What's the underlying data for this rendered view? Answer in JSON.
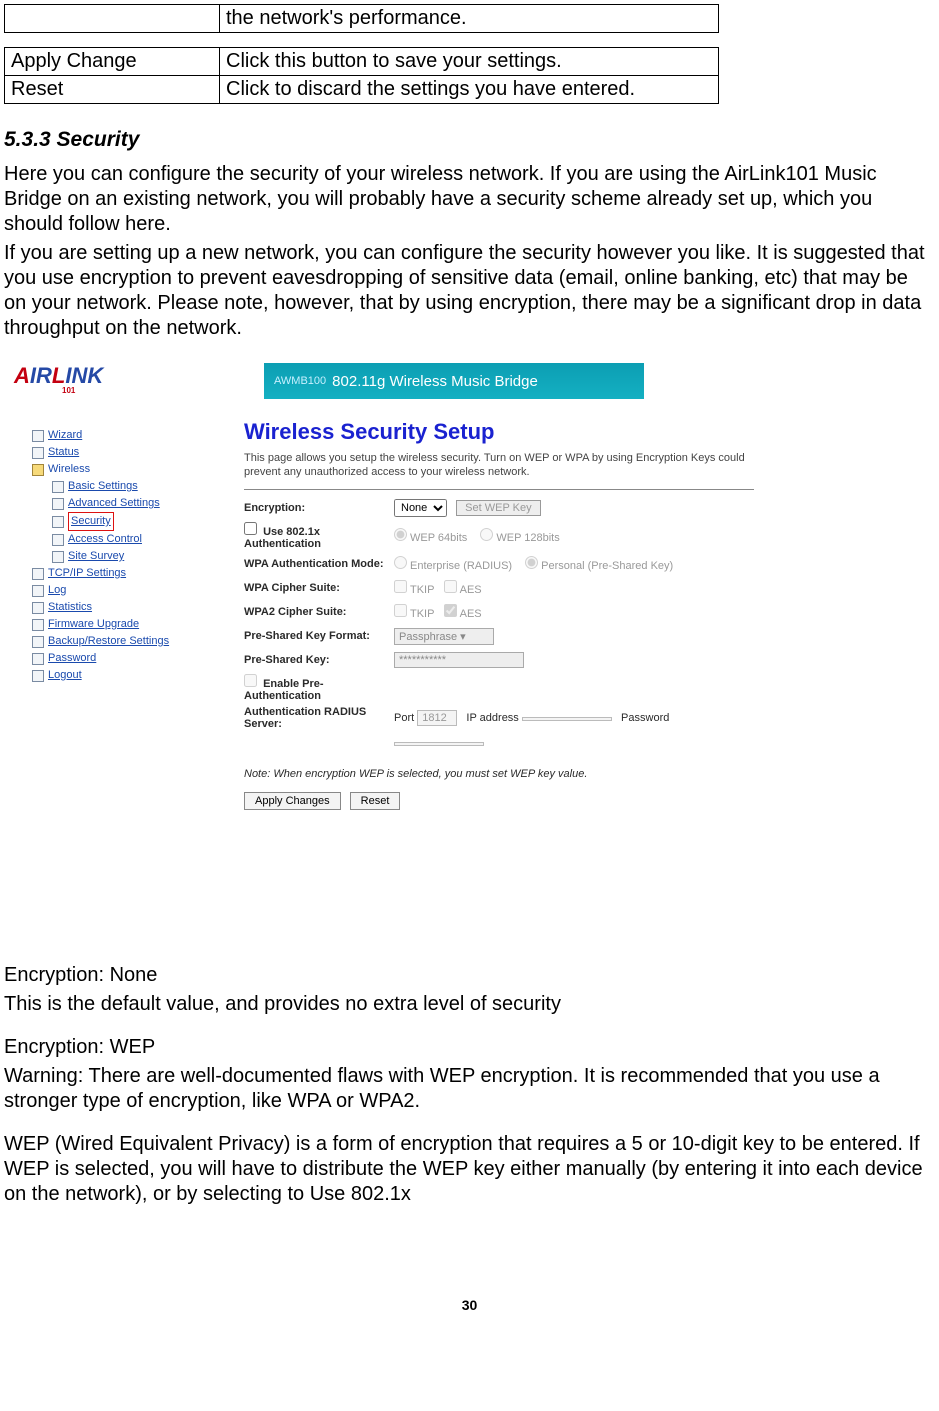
{
  "tables": {
    "t1": {
      "c1": "",
      "c2": "the network's performance."
    },
    "t2": [
      {
        "c1": "Apply Change",
        "c2": "Click this button to save your settings."
      },
      {
        "c1": "Reset",
        "c2": "Click to discard the settings you have entered."
      }
    ]
  },
  "heading": "5.3.3 Security",
  "para1": "Here you can configure the security of your wireless network. If you are using the AirLink101 Music Bridge on an existing network, you will probably have a security scheme already set up, which you should follow here.",
  "para2": "If you are setting up a new network, you can configure the security however you like. It is suggested that you use encryption to prevent eavesdropping of sensitive data (email, online banking, etc) that may be on your network. Please note, however, that by using encryption, there may be a significant drop in data throughput on the network.",
  "shot": {
    "banner_code": "AWMB100",
    "banner_text": "802.11g Wireless Music Bridge",
    "tree": {
      "wizard": "Wizard",
      "status": "Status",
      "wireless": "Wireless",
      "basic": "Basic Settings",
      "advanced": "Advanced Settings",
      "security": "Security",
      "access": "Access Control",
      "survey": "Site Survey",
      "tcpip": "TCP/IP Settings",
      "log": "Log",
      "stats": "Statistics",
      "fw": "Firmware Upgrade",
      "backup": "Backup/Restore Settings",
      "password": "Password",
      "logout": "Logout"
    },
    "panel": {
      "title": "Wireless Security Setup",
      "desc": "This page allows you setup the wireless security. Turn on WEP or WPA by using Encryption Keys could prevent any unauthorized access to your wireless network.",
      "encryption_label": "Encryption:",
      "encryption_value": "None",
      "setwep": "Set WEP Key",
      "use8021x": "Use 802.1x Authentication",
      "wep64": "WEP 64bits",
      "wep128": "WEP 128bits",
      "wpa_mode_label": "WPA Authentication Mode:",
      "wpa_enterprise": "Enterprise (RADIUS)",
      "wpa_personal": "Personal (Pre-Shared Key)",
      "wpa_cipher_label": "WPA Cipher Suite:",
      "wpa2_cipher_label": "WPA2 Cipher Suite:",
      "tkip": "TKIP",
      "aes": "AES",
      "psk_format_label": "Pre-Shared Key Format:",
      "psk_format_value": "Passphrase",
      "psk_label": "Pre-Shared Key:",
      "psk_value": "***********",
      "preauth": "Enable Pre-Authentication",
      "radius_label": "Authentication RADIUS Server:",
      "port_label": "Port",
      "port_value": "1812",
      "ip_label": "IP address",
      "pw_label": "Password",
      "note": "Note: When encryption WEP is selected, you must set WEP key value.",
      "apply": "Apply Changes",
      "reset": "Reset"
    }
  },
  "after": {
    "enc_none_h": "Encryption: None",
    "enc_none_b": "This is the default value, and provides no extra level of security",
    "enc_wep_h": "Encryption: WEP",
    "enc_wep_warn": "Warning: There are well-documented flaws with WEP encryption. It is recommended that you use a stronger type of encryption, like WPA or WPA2.",
    "enc_wep_b": "WEP (Wired Equivalent Privacy) is a form of encryption that requires a 5 or 10-digit key to be entered. If WEP is selected, you will have to distribute the WEP key either manually (by entering it into each device on the network), or by selecting to Use 802.1x"
  },
  "page_number": "30"
}
